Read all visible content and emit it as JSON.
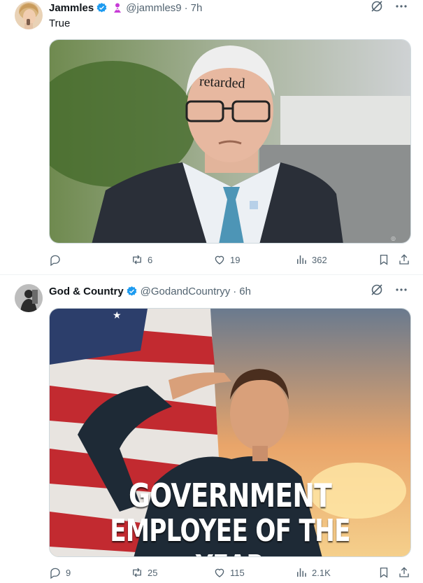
{
  "tweets": [
    {
      "author": {
        "name": "Jammles",
        "handle": "@jammles9",
        "verified": true,
        "affiliate_badge": true
      },
      "time": "7h",
      "text": "True",
      "media_overlay_text": "retarded",
      "icons": {
        "grok": "grok-icon",
        "more": "more-icon"
      },
      "stats": {
        "replies": "",
        "retweets": "6",
        "likes": "19",
        "views": "362"
      }
    },
    {
      "author": {
        "name": "God & Country",
        "handle": "@GodandCountryy",
        "verified": true,
        "affiliate_badge": false
      },
      "time": "6h",
      "text": "",
      "media_overlay_text": [
        "GOVERNMENT",
        "EMPLOYEE OF THE YEAR"
      ],
      "icons": {
        "grok": "grok-icon",
        "more": "more-icon"
      },
      "stats": {
        "replies": "9",
        "retweets": "25",
        "likes": "115",
        "views": "2.1K"
      }
    }
  ],
  "colors": {
    "verified": "#1d9bf0",
    "affiliate": "#c73ad6",
    "muted": "#536471",
    "text": "#0f1419",
    "divider": "#eff3f4"
  },
  "dot": "·"
}
